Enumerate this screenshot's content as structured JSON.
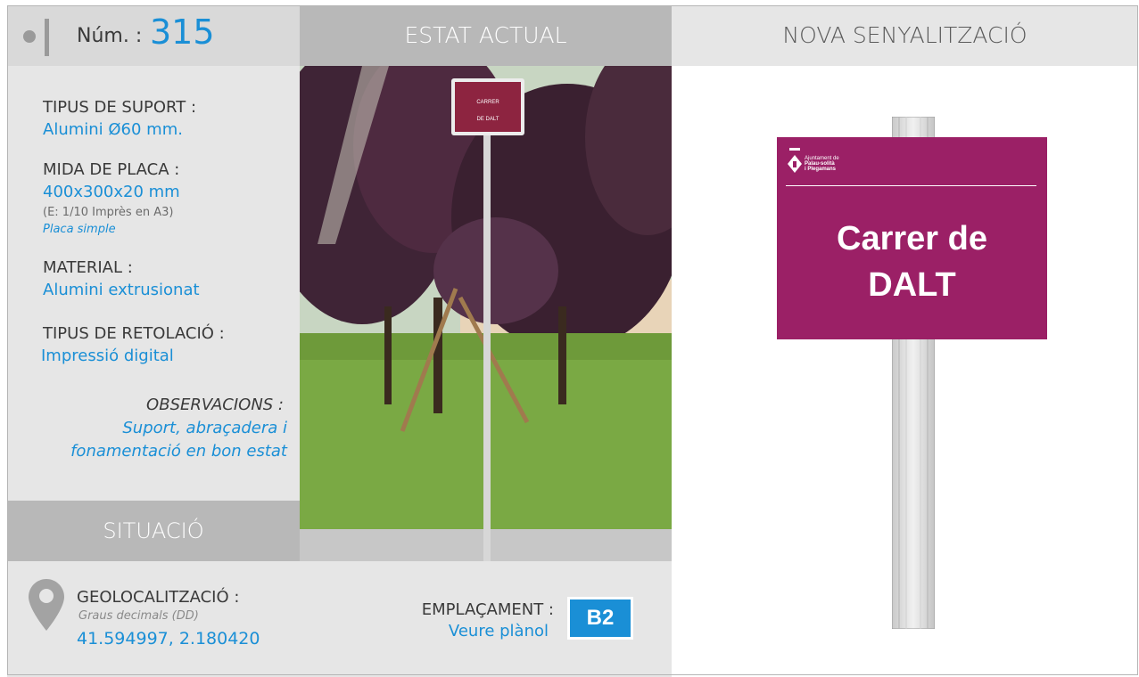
{
  "header": {
    "num_label": "Núm. :",
    "num_value": "315",
    "estat_actual": "ESTAT ACTUAL",
    "nova_senyalitzacio": "NOVA SENYALITZACIÓ"
  },
  "specs": {
    "tipus_suport_label": "TIPUS DE SUPORT :",
    "tipus_suport_value": "Alumini Ø60 mm.",
    "mida_placa_label": "MIDA DE PLACA :",
    "mida_placa_value": "400x300x20 mm",
    "mida_placa_note": "(E: 1/10 Imprès en A3)",
    "mida_placa_type": "Placa simple",
    "material_label": "MATERIAL :",
    "material_value": "Alumini extrusionat",
    "retolacio_label": "TIPUS DE RETOLACIÓ :",
    "retolacio_value": "Impressió digital",
    "observacions_label": "OBSERVACIONS :",
    "observacions_line1": "Suport, abraçadera i",
    "observacions_line2": "fonamentació en bon estat"
  },
  "situacio": {
    "title": "SITUACIÓ",
    "geo_label": "GEOLOCALITZACIÓ :",
    "geo_format": "Graus decimals (DD)",
    "geo_coords": "41.594997, 2.180420",
    "emplacament_label": "EMPLAÇAMENT :",
    "emplacament_link": "Veure plànol",
    "emplacament_code": "B2"
  },
  "photo": {
    "old_sign_line1": "CARRER",
    "old_sign_line2": "DE DALT"
  },
  "new_sign": {
    "logo_line1": "Ajuntament de",
    "logo_line2": "Palau-solità",
    "logo_line3": "i Plegamans",
    "street_line1": "Carrer de",
    "street_line2": "DALT"
  },
  "colors": {
    "accent": "#1a8fd6",
    "sign_plate": "#9b2066",
    "header_dark": "#b8b8b8",
    "panel": "#e6e6e6"
  }
}
